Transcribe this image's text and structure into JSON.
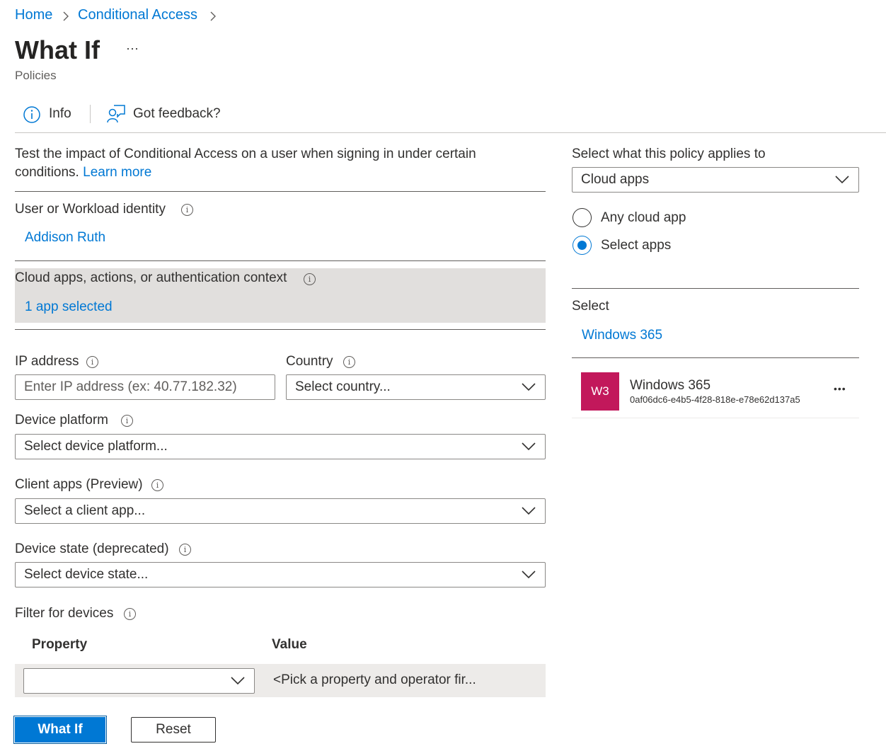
{
  "breadcrumb": {
    "items": [
      "Home",
      "Conditional Access"
    ]
  },
  "page": {
    "title": "What If",
    "more": "···",
    "subtitle": "Policies"
  },
  "toolbar": {
    "info_label": "Info",
    "feedback_label": "Got feedback?"
  },
  "intro": {
    "text": "Test the impact of Conditional Access on a user when signing in under certain conditions.",
    "learn_more": "Learn more"
  },
  "user": {
    "label": "User or Workload identity",
    "value": "Addison Ruth"
  },
  "cloud_apps": {
    "label": "Cloud apps, actions, or authentication context",
    "value": "1 app selected"
  },
  "ip": {
    "label": "IP address",
    "placeholder": "Enter IP address (ex: 40.77.182.32)"
  },
  "country": {
    "label": "Country",
    "value": "Select country..."
  },
  "device_platform": {
    "label": "Device platform",
    "value": "Select device platform..."
  },
  "client_apps": {
    "label": "Client apps (Preview)",
    "value": "Select a client app..."
  },
  "device_state": {
    "label": "Device state (deprecated)",
    "value": "Select device state..."
  },
  "filter": {
    "label": "Filter for devices",
    "columns": [
      "Property",
      "Value"
    ],
    "row": {
      "property": "",
      "value": "<Pick a property and operator fir..."
    }
  },
  "buttons": {
    "what_if": "What If",
    "reset": "Reset"
  },
  "right": {
    "applies_label": "Select what this policy applies to",
    "applies_value": "Cloud apps",
    "radio_any": "Any cloud app",
    "radio_select": "Select apps",
    "select_label": "Select",
    "select_link": "Windows 365",
    "app": {
      "avatar": "W3",
      "avatar_color": "#c2185b",
      "name": "Windows 365",
      "id": "0af06dc6-e4b5-4f28-818e-e78e62d137a5",
      "more": "•••"
    }
  },
  "colors": {
    "accent": "#0078d4",
    "highlight_bg": "#e1dfdd"
  }
}
